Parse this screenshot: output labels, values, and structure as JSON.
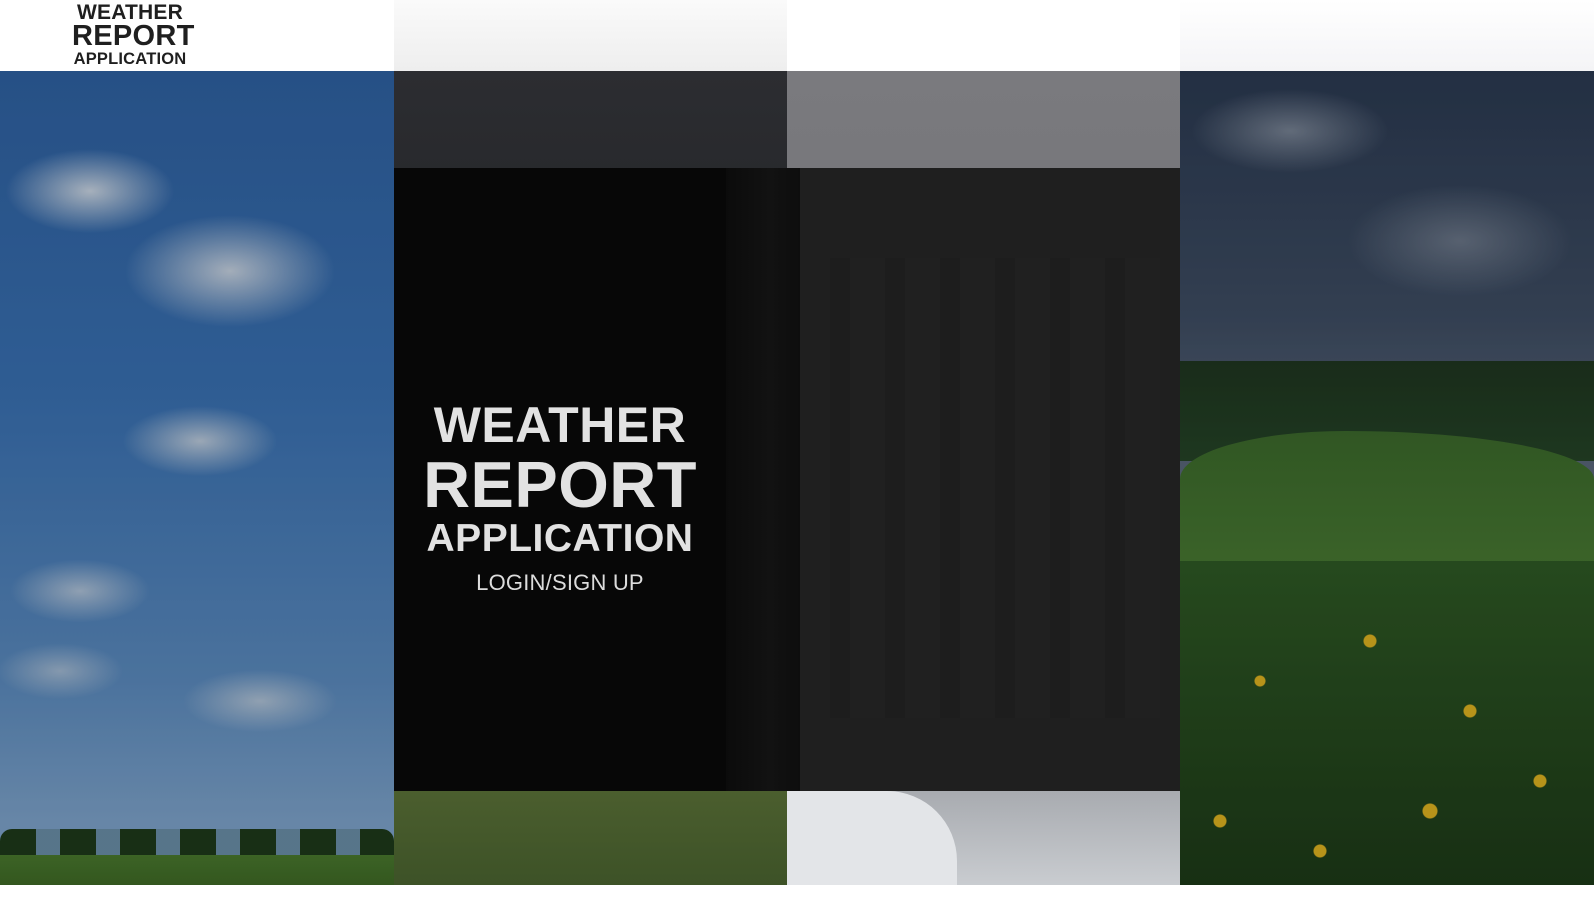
{
  "header": {
    "logo_line1": "WEATHER",
    "logo_line2": "REPORT",
    "logo_line3": "APPLICATION"
  },
  "hero": {
    "title_line1": "WEATHER",
    "title_line2": "REPORT",
    "title_line3": "APPLICATION",
    "login_link": "LOGIN/SIGN UP"
  },
  "panels": [
    {
      "scene": "blue-sky-field"
    },
    {
      "scene": "storm-field"
    },
    {
      "scene": "snow"
    },
    {
      "scene": "meadow-flowers"
    }
  ],
  "colors": {
    "hero_card": "#070707",
    "hero_card_right": "#1f1f1f",
    "text_light": "#e2e2e2",
    "logo_text": "#1f1f1f"
  }
}
